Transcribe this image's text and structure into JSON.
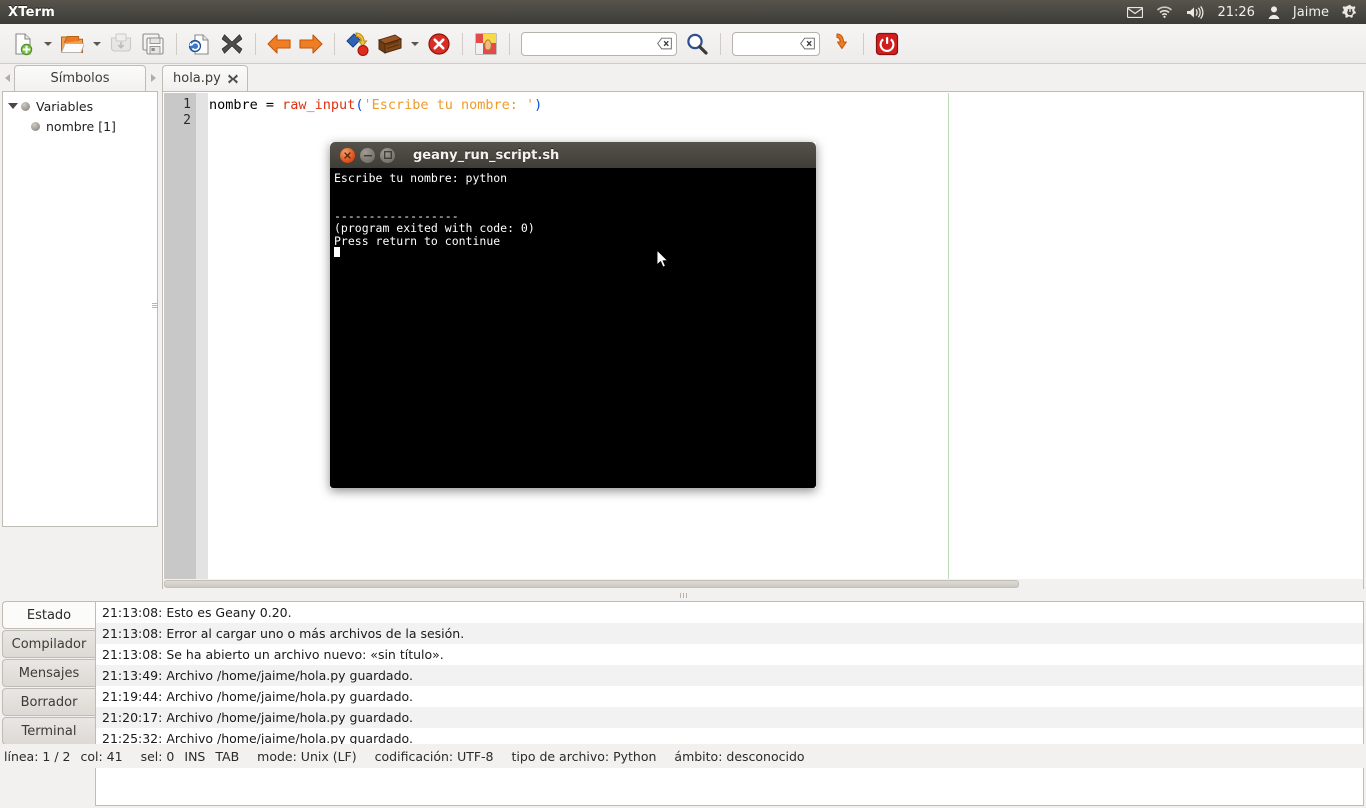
{
  "top_panel": {
    "app_title": "XTerm",
    "tray": {
      "mail_icon": "envelope-icon",
      "wifi_icon": "wifi-icon",
      "volume_icon": "volume-icon",
      "clock": "21:26",
      "user_icon": "user-icon",
      "user_name": "Jaime",
      "session_icon": "gear-power-icon"
    }
  },
  "toolbar": {
    "new_label": "new-document-icon",
    "open_label": "open-folder-icon",
    "save_label": "save-icon",
    "save_all_label": "save-all-icon",
    "revert_label": "revert-icon",
    "close_label": "close-document-icon",
    "back_label": "navigate-back-icon",
    "forward_label": "navigate-forward-icon",
    "compile_label": "compile-icon",
    "build_label": "build-icon",
    "stop_label": "stop-icon",
    "color_label": "color-chooser-icon",
    "search_value": "",
    "search_placeholder": "",
    "goto_value": "",
    "goto_placeholder": "",
    "jump_label": "jump-to-icon",
    "quit_label": "quit-icon"
  },
  "sidebar": {
    "tab_label": "Símbolos",
    "tree": [
      {
        "label": "Variables",
        "level": 0,
        "expanded": true
      },
      {
        "label": "nombre [1]",
        "level": 1,
        "expanded": false
      }
    ]
  },
  "editor": {
    "tab_label": "hola.py",
    "line_numbers": [
      "1",
      "2"
    ],
    "code": {
      "segments": [
        {
          "text": "nombre = ",
          "type": "plain"
        },
        {
          "text": "raw_input",
          "type": "fn"
        },
        {
          "text": "(",
          "type": "paren"
        },
        {
          "text": "'Escribe tu nombre: '",
          "type": "str"
        },
        {
          "text": ")",
          "type": "paren"
        }
      ]
    }
  },
  "terminal_window": {
    "title": "geany_run_script.sh",
    "close_icon": "window-close-icon",
    "minimize_icon": "window-minimize-icon",
    "maximize_icon": "window-maximize-icon",
    "lines": [
      "Escribe tu nombre: python",
      "",
      "",
      "------------------",
      "(program exited with code: 0)",
      "Press return to continue"
    ],
    "mouse_cursor_icon": "mouse-pointer-icon"
  },
  "message_window": {
    "tabs": [
      {
        "label": "Estado",
        "active": true
      },
      {
        "label": "Compilador",
        "active": false
      },
      {
        "label": "Mensajes",
        "active": false
      },
      {
        "label": "Borrador",
        "active": false
      },
      {
        "label": "Terminal",
        "active": false
      }
    ],
    "rows": [
      "21:13:08: Esto es Geany 0.20.",
      "21:13:08: Error al cargar uno o más archivos de la sesión.",
      "21:13:08: Se ha abierto un archivo nuevo: «sin título».",
      "21:13:49: Archivo /home/jaime/hola.py guardado.",
      "21:19:44: Archivo /home/jaime/hola.py guardado.",
      "21:20:17: Archivo /home/jaime/hola.py guardado.",
      "21:25:32: Archivo /home/jaime/hola.py guardado."
    ]
  },
  "statusbar": {
    "line": "línea: 1 / 2",
    "col": "col: 41",
    "sel": "sel: 0",
    "ins": "INS",
    "tab": "TAB",
    "mode": "mode: Unix (LF)",
    "encoding": "codificación: UTF-8",
    "filetype": "tipo de archivo: Python",
    "scope": "ámbito: desconocido"
  },
  "colors": {
    "panel_dark": "#4a4841",
    "accent_orange": "#dd4814",
    "string_orange": "#ee9b2a",
    "function_red": "#dd3311",
    "paren_blue": "#0b54cf",
    "margin_green": "#b9dcb4"
  }
}
